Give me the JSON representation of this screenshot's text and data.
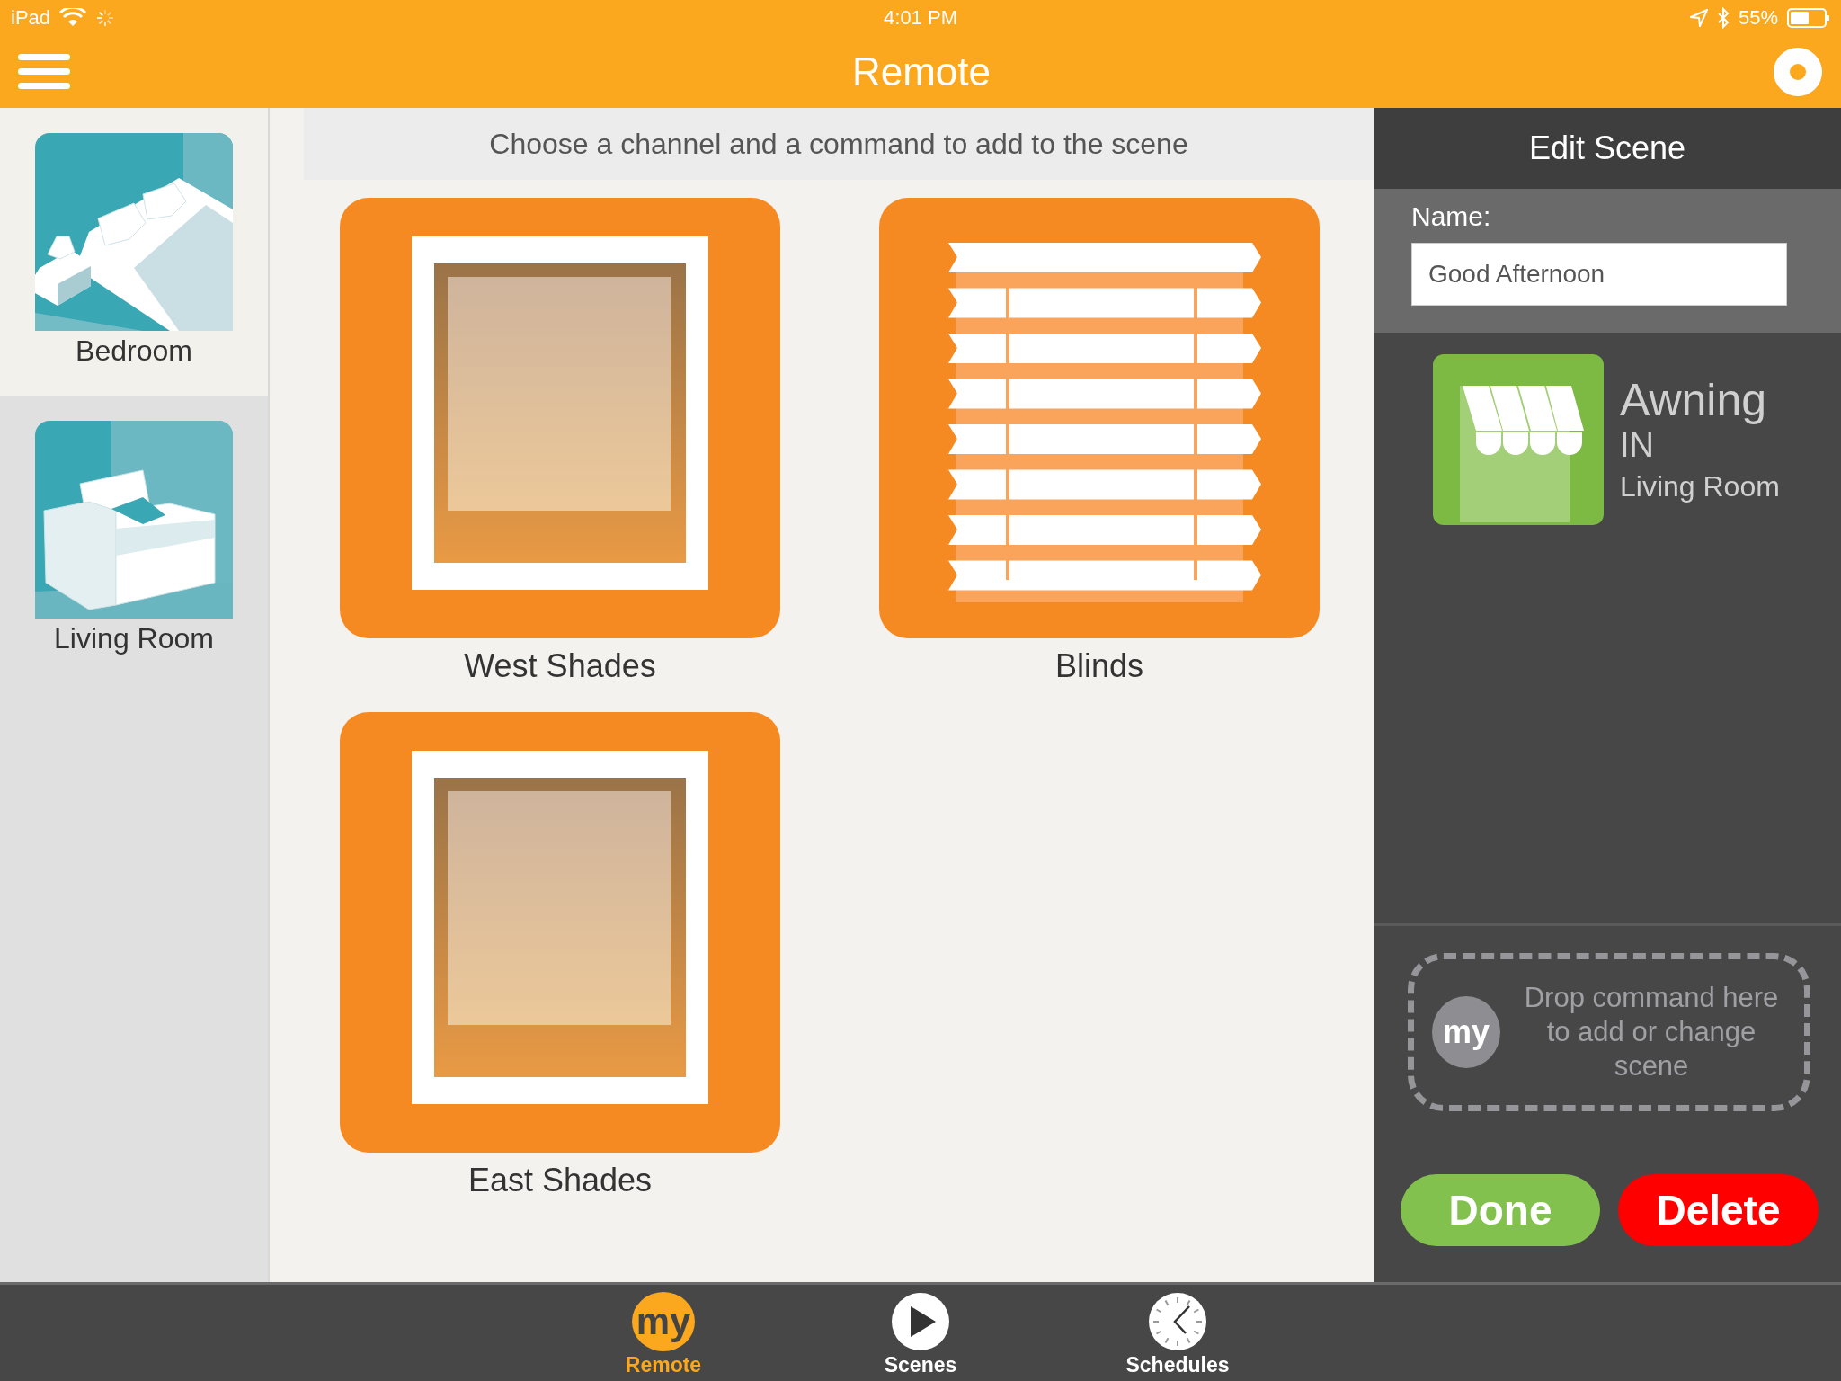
{
  "status_bar": {
    "carrier": "iPad",
    "time": "4:01 PM",
    "battery": "55%"
  },
  "header": {
    "title": "Remote"
  },
  "rooms": [
    {
      "name": "Bedroom",
      "kind": "bedroom",
      "selected": true
    },
    {
      "name": "Living Room",
      "kind": "living",
      "selected": false
    }
  ],
  "instruction": "Choose a channel and a command to add to the scene",
  "channels": [
    {
      "name": "West Shades",
      "kind": "shade"
    },
    {
      "name": "Blinds",
      "kind": "blinds"
    },
    {
      "name": "East Shades",
      "kind": "shade"
    }
  ],
  "edit_scene": {
    "title": "Edit Scene",
    "name_label": "Name:",
    "name_value": "Good Afternoon",
    "commands": [
      {
        "device": "Awning",
        "command": "IN",
        "room": "Living Room",
        "kind": "awning"
      }
    ],
    "drop_zone": {
      "logo": "my",
      "text": "Drop command here to add or change scene"
    },
    "buttons": [
      {
        "label": "Done",
        "kind": "done"
      },
      {
        "label": "Delete",
        "kind": "delete"
      }
    ]
  },
  "tabs": [
    {
      "label": "Remote",
      "icon_text": "my",
      "kind": "remote",
      "selected": true
    },
    {
      "label": "Scenes",
      "kind": "scenes",
      "selected": false
    },
    {
      "label": "Schedules",
      "kind": "schedules",
      "selected": false
    }
  ]
}
